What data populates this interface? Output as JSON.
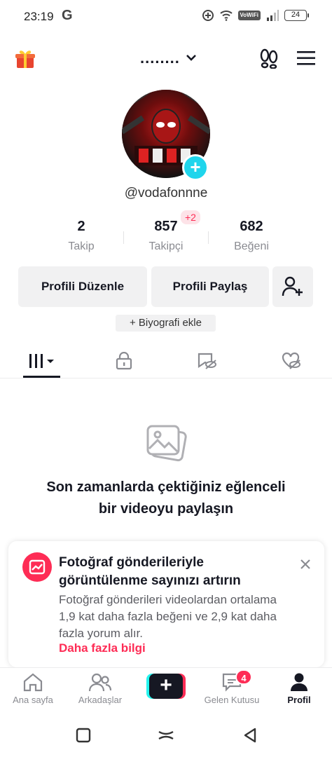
{
  "status_bar": {
    "time": "23:19",
    "g_logo": "G",
    "vowifi": "VoWiFi",
    "battery": "24"
  },
  "header": {
    "username": "........",
    "icons": [
      "gift-icon",
      "footprint-icon",
      "menu-icon"
    ]
  },
  "profile": {
    "handle": "@vodafonnne",
    "stats": [
      {
        "value": "2",
        "label": "Takip"
      },
      {
        "value": "857",
        "label": "Takipçi",
        "badge": "+2"
      },
      {
        "value": "682",
        "label": "Beğeni"
      }
    ],
    "buttons": {
      "edit": "Profili Düzenle",
      "share": "Profili Paylaş"
    },
    "bio_add": "+ Biyografi ekle"
  },
  "tabs": [
    "videos-tab",
    "private-tab",
    "reposts-tab",
    "liked-tab"
  ],
  "empty_state": {
    "text": "Son zamanlarda çektiğiniz eğlenceli bir videoyu paylaşın"
  },
  "promo": {
    "title": "Fotoğraf gönderileriyle görüntülenme sayınızı artırın",
    "body": "Fotoğraf gönderileri videolardan ortalama 1,9 kat daha fazla beğeni ve 2,9 kat daha fazla yorum alır.",
    "link": "Daha fazla bilgi"
  },
  "bottom_nav": {
    "items": [
      {
        "label": "Ana sayfa"
      },
      {
        "label": "Arkadaşlar"
      },
      {
        "label": ""
      },
      {
        "label": "Gelen Kutusu",
        "badge": "4"
      },
      {
        "label": "Profil"
      }
    ]
  },
  "colors": {
    "accent": "#fe2c55",
    "cyan": "#20d5ec",
    "text": "#161823",
    "muted": "#8a8b91"
  }
}
